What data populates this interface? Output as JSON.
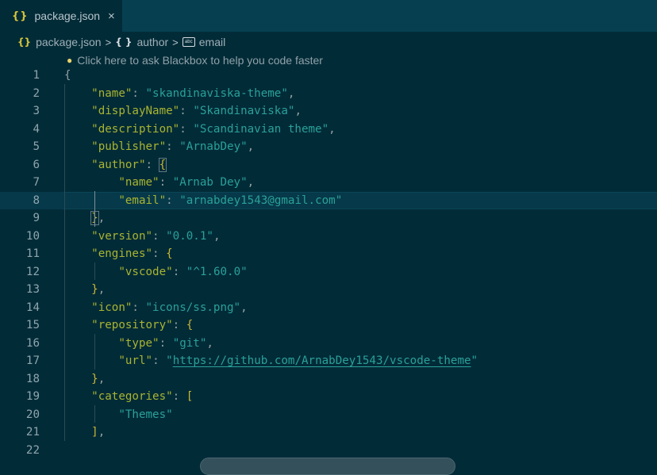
{
  "tab": {
    "icon": "json-braces-icon",
    "label": "package.json",
    "close": "×"
  },
  "breadcrumb": {
    "items": [
      {
        "icon": "json-braces-icon",
        "label": "package.json"
      },
      {
        "icon": "object-braces-icon",
        "label": "author"
      },
      {
        "icon": "string-icon",
        "label": "email"
      }
    ],
    "separator": ">"
  },
  "hint": {
    "icon": "lightbulb-icon",
    "text": "Click here to ask Blackbox to help you code faster"
  },
  "editor": {
    "current_line": 8,
    "lines": [
      {
        "n": "1",
        "tokens": [
          {
            "t": "{",
            "c": "p"
          }
        ]
      },
      {
        "n": "2",
        "tokens": [
          {
            "t": "    "
          },
          {
            "t": "\"name\"",
            "c": "k"
          },
          {
            "t": ": ",
            "c": "p"
          },
          {
            "t": "\"skandinaviska-theme\"",
            "c": "s"
          },
          {
            "t": ",",
            "c": "p"
          }
        ]
      },
      {
        "n": "3",
        "tokens": [
          {
            "t": "    "
          },
          {
            "t": "\"displayName\"",
            "c": "k"
          },
          {
            "t": ": ",
            "c": "p"
          },
          {
            "t": "\"Skandinaviska\"",
            "c": "s"
          },
          {
            "t": ",",
            "c": "p"
          }
        ]
      },
      {
        "n": "4",
        "tokens": [
          {
            "t": "    "
          },
          {
            "t": "\"description\"",
            "c": "k"
          },
          {
            "t": ": ",
            "c": "p"
          },
          {
            "t": "\"Scandinavian theme\"",
            "c": "s"
          },
          {
            "t": ",",
            "c": "p"
          }
        ]
      },
      {
        "n": "5",
        "tokens": [
          {
            "t": "    "
          },
          {
            "t": "\"publisher\"",
            "c": "k"
          },
          {
            "t": ": ",
            "c": "p"
          },
          {
            "t": "\"ArnabDey\"",
            "c": "s"
          },
          {
            "t": ",",
            "c": "p"
          }
        ]
      },
      {
        "n": "6",
        "tokens": [
          {
            "t": "    "
          },
          {
            "t": "\"author\"",
            "c": "k"
          },
          {
            "t": ": ",
            "c": "p"
          },
          {
            "t": "{",
            "c": "b bm"
          }
        ]
      },
      {
        "n": "7",
        "tokens": [
          {
            "t": "        "
          },
          {
            "t": "\"name\"",
            "c": "k"
          },
          {
            "t": ": ",
            "c": "p"
          },
          {
            "t": "\"Arnab Dey\"",
            "c": "s"
          },
          {
            "t": ",",
            "c": "p"
          }
        ]
      },
      {
        "n": "8",
        "tokens": [
          {
            "t": "        "
          },
          {
            "t": "\"email\"",
            "c": "k"
          },
          {
            "t": ": ",
            "c": "p"
          },
          {
            "t": "\"arnabdey1543@gmail.com\"",
            "c": "s"
          }
        ]
      },
      {
        "n": "9",
        "tokens": [
          {
            "t": "    "
          },
          {
            "t": "}",
            "c": "b bm"
          },
          {
            "t": ",",
            "c": "p"
          }
        ]
      },
      {
        "n": "10",
        "tokens": [
          {
            "t": "    "
          },
          {
            "t": "\"version\"",
            "c": "k"
          },
          {
            "t": ": ",
            "c": "p"
          },
          {
            "t": "\"0.0.1\"",
            "c": "s"
          },
          {
            "t": ",",
            "c": "p"
          }
        ]
      },
      {
        "n": "11",
        "tokens": [
          {
            "t": "    "
          },
          {
            "t": "\"engines\"",
            "c": "k"
          },
          {
            "t": ": ",
            "c": "p"
          },
          {
            "t": "{",
            "c": "b"
          }
        ]
      },
      {
        "n": "12",
        "tokens": [
          {
            "t": "        "
          },
          {
            "t": "\"vscode\"",
            "c": "k"
          },
          {
            "t": ": ",
            "c": "p"
          },
          {
            "t": "\"^1.60.0\"",
            "c": "s"
          }
        ]
      },
      {
        "n": "13",
        "tokens": [
          {
            "t": "    "
          },
          {
            "t": "}",
            "c": "b"
          },
          {
            "t": ",",
            "c": "p"
          }
        ]
      },
      {
        "n": "14",
        "tokens": [
          {
            "t": "    "
          },
          {
            "t": "\"icon\"",
            "c": "k"
          },
          {
            "t": ": ",
            "c": "p"
          },
          {
            "t": "\"icons/ss.png\"",
            "c": "s"
          },
          {
            "t": ",",
            "c": "p"
          }
        ]
      },
      {
        "n": "15",
        "tokens": [
          {
            "t": "    "
          },
          {
            "t": "\"repository\"",
            "c": "k"
          },
          {
            "t": ": ",
            "c": "p"
          },
          {
            "t": "{",
            "c": "b"
          }
        ]
      },
      {
        "n": "16",
        "tokens": [
          {
            "t": "        "
          },
          {
            "t": "\"type\"",
            "c": "k"
          },
          {
            "t": ": ",
            "c": "p"
          },
          {
            "t": "\"git\"",
            "c": "s"
          },
          {
            "t": ",",
            "c": "p"
          }
        ]
      },
      {
        "n": "17",
        "tokens": [
          {
            "t": "        "
          },
          {
            "t": "\"url\"",
            "c": "k"
          },
          {
            "t": ": ",
            "c": "p"
          },
          {
            "t": "\"",
            "c": "s"
          },
          {
            "t": "https://github.com/ArnabDey1543/vscode-theme",
            "c": "u"
          },
          {
            "t": "\"",
            "c": "s"
          }
        ]
      },
      {
        "n": "18",
        "tokens": [
          {
            "t": "    "
          },
          {
            "t": "}",
            "c": "b"
          },
          {
            "t": ",",
            "c": "p"
          }
        ]
      },
      {
        "n": "19",
        "tokens": [
          {
            "t": "    "
          },
          {
            "t": "\"categories\"",
            "c": "k"
          },
          {
            "t": ": ",
            "c": "p"
          },
          {
            "t": "[",
            "c": "b"
          }
        ]
      },
      {
        "n": "20",
        "tokens": [
          {
            "t": "        "
          },
          {
            "t": "\"Themes\"",
            "c": "s"
          }
        ]
      },
      {
        "n": "21",
        "tokens": [
          {
            "t": "    "
          },
          {
            "t": "]",
            "c": "b"
          },
          {
            "t": ",",
            "c": "p"
          }
        ]
      },
      {
        "n": "22",
        "tokens": []
      }
    ]
  },
  "colors": {
    "background": "#022b38",
    "tabbar": "#063f50",
    "key": "#a8b431",
    "string": "#2aa198",
    "bracket": "#c9b634",
    "line_number": "#8fa6ad"
  }
}
